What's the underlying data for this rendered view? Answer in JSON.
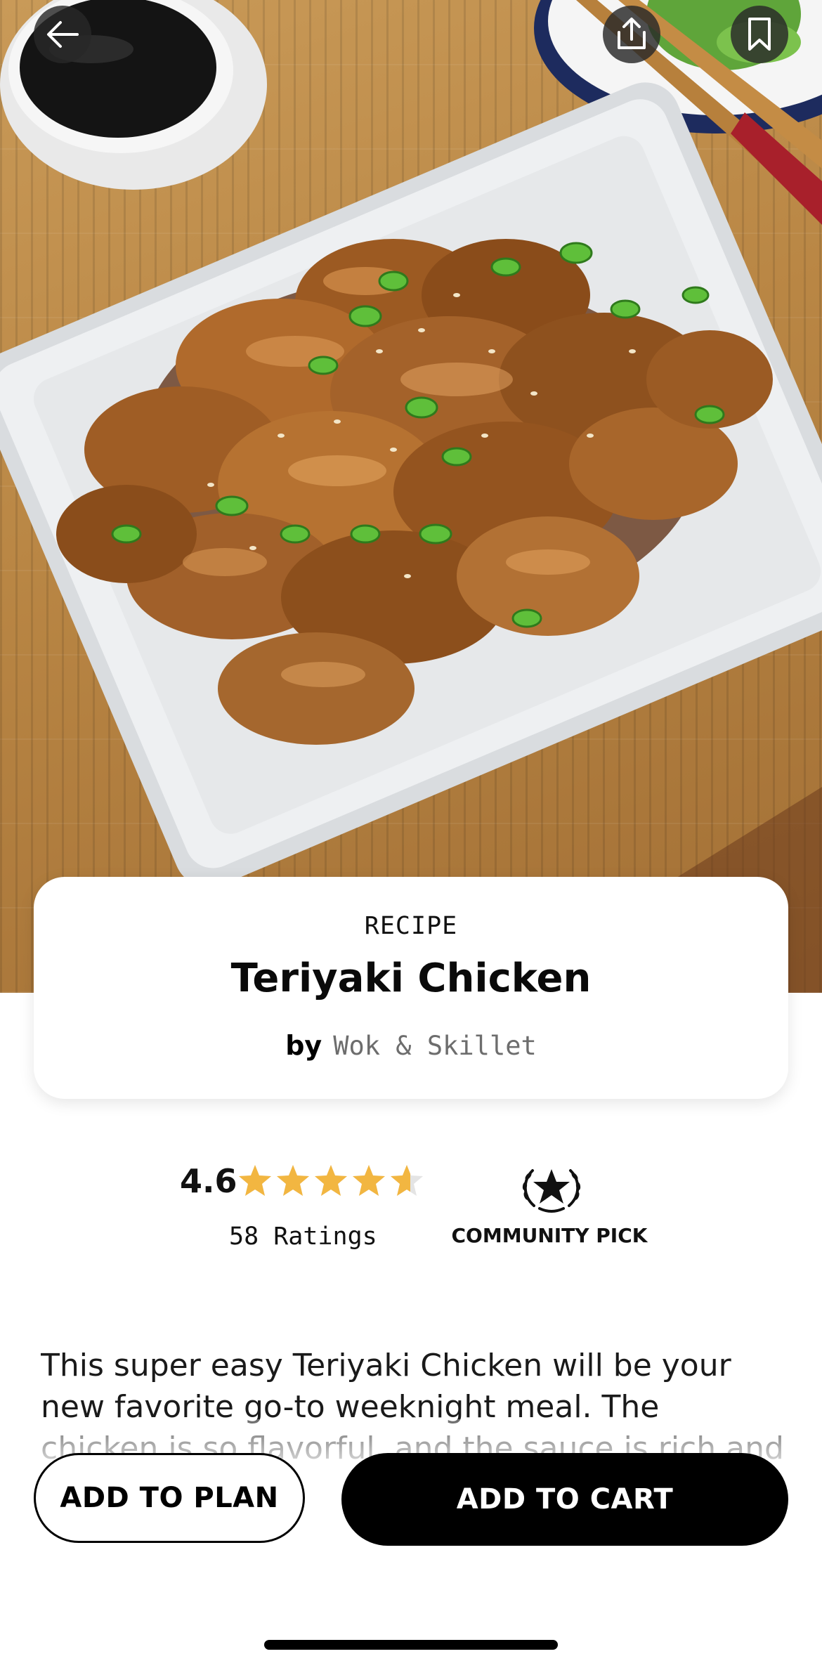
{
  "hero": {
    "image_description_icon": "teriyaki-chicken-photo"
  },
  "nav": {
    "back_icon": "arrow-left-icon",
    "share_icon": "share-upload-icon",
    "bookmark_icon": "bookmark-icon"
  },
  "card": {
    "kicker": "RECIPE",
    "title": "Teriyaki Chicken",
    "by_label": "by",
    "author": "Wok & Skillet"
  },
  "rating": {
    "value_label": "4.6",
    "value": 4.6,
    "max": 5,
    "count_label": "58 Ratings",
    "star_color": "#f2b641",
    "star_empty_color": "#e4e4e4"
  },
  "badge": {
    "icon": "laurel-star-icon",
    "label": "COMMUNITY PICK"
  },
  "description": {
    "text": "This super easy Teriyaki Chicken will be your new favorite go-to weeknight meal. The chicken is so flavorful, and the sauce is rich and thick. Nobody will believe it took only"
  },
  "actions": {
    "add_to_plan": "ADD TO PLAN",
    "add_to_cart": "ADD TO CART"
  }
}
